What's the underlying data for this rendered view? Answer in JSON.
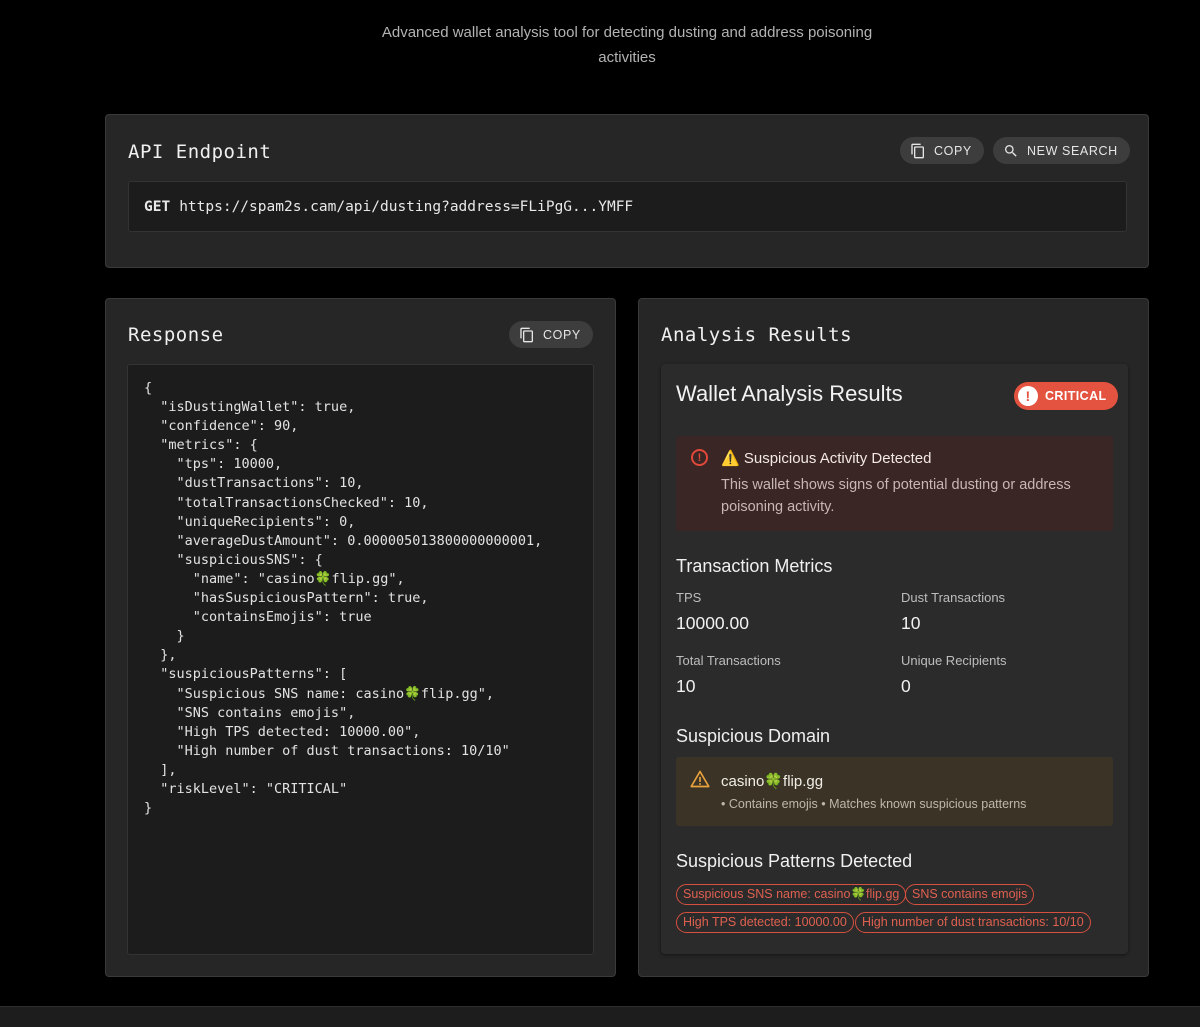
{
  "header": {
    "subtitle_line1": "Advanced wallet analysis tool for detecting dusting and address poisoning",
    "subtitle_line2": "activities"
  },
  "api_card": {
    "title": "API Endpoint",
    "copy_label": "COPY",
    "new_search_label": "NEW SEARCH",
    "method": "GET",
    "url": "https://spam2s.cam/api/dusting?address=FLiPgG...YMFF"
  },
  "response_card": {
    "title": "Response",
    "copy_label": "COPY",
    "json_text": "{\n  \"isDustingWallet\": true,\n  \"confidence\": 90,\n  \"metrics\": {\n    \"tps\": 10000,\n    \"dustTransactions\": 10,\n    \"totalTransactionsChecked\": 10,\n    \"uniqueRecipients\": 0,\n    \"averageDustAmount\": 0.000005013800000000001,\n    \"suspiciousSNS\": {\n      \"name\": \"casino🍀flip.gg\",\n      \"hasSuspiciousPattern\": true,\n      \"containsEmojis\": true\n    }\n  },\n  \"suspiciousPatterns\": [\n    \"Suspicious SNS name: casino🍀flip.gg\",\n    \"SNS contains emojis\",\n    \"High TPS detected: 10000.00\",\n    \"High number of dust transactions: 10/10\"\n  ],\n  \"riskLevel\": \"CRITICAL\"\n}"
  },
  "analysis_card": {
    "title": "Analysis Results",
    "heading": "Wallet Analysis Results",
    "badge": "CRITICAL",
    "badge_color": "#e4533f",
    "alert": {
      "title": "⚠️ Suspicious Activity Detected",
      "body": "This wallet shows signs of potential dusting or address poisoning activity."
    },
    "metrics_heading": "Transaction Metrics",
    "metrics": [
      {
        "label": "TPS",
        "value": "10000.00"
      },
      {
        "label": "Dust Transactions",
        "value": "10"
      },
      {
        "label": "Total Transactions",
        "value": "10"
      },
      {
        "label": "Unique Recipients",
        "value": "0"
      }
    ],
    "domain_heading": "Suspicious Domain",
    "domain": {
      "name": "casino🍀flip.gg",
      "meta": "• Contains emojis • Matches known suspicious patterns"
    },
    "patterns_heading": "Suspicious Patterns Detected",
    "patterns": [
      "Suspicious SNS name: casino🍀flip.gg",
      "SNS contains emojis",
      "High TPS detected: 10000.00",
      "High number of dust transactions: 10/10"
    ]
  }
}
